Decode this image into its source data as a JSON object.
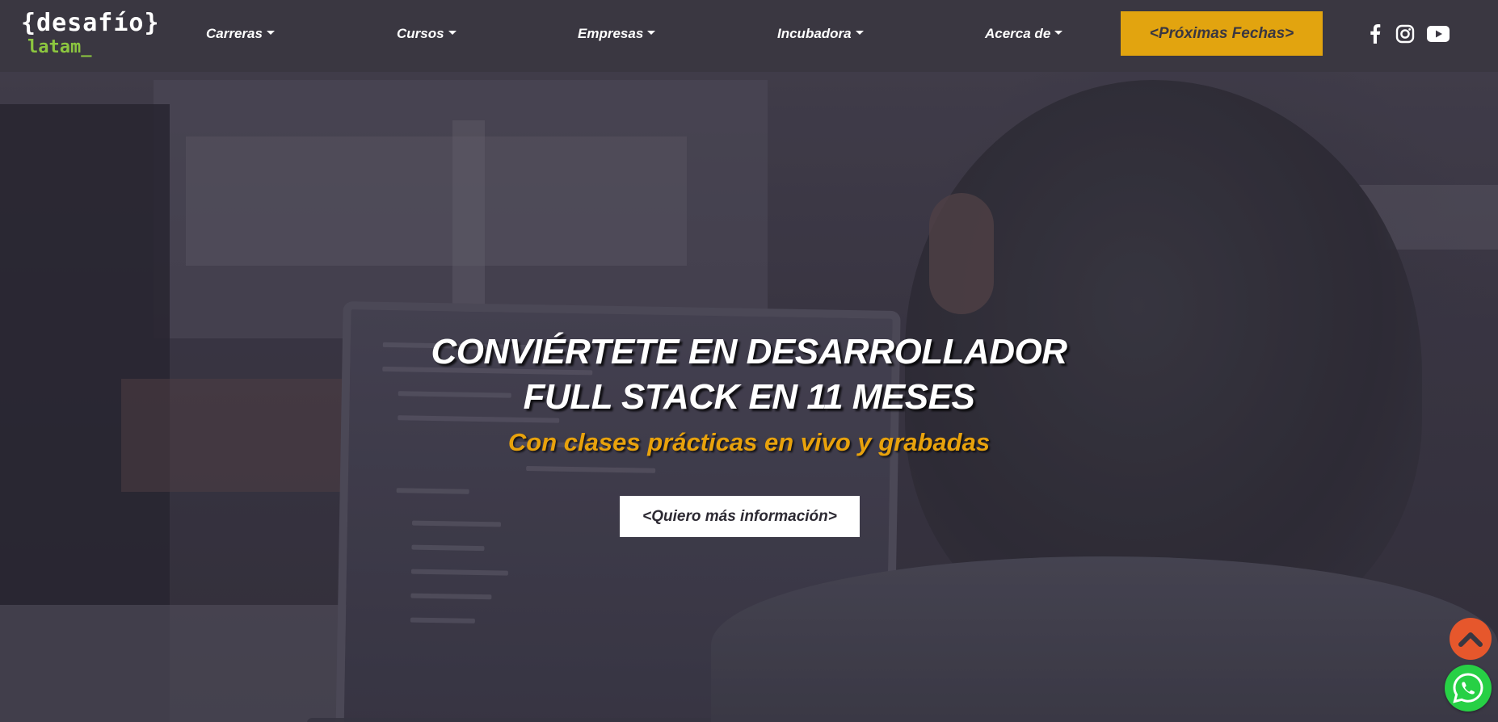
{
  "header": {
    "logo": {
      "top": "{desafío}",
      "bottom": "latam_"
    },
    "nav": [
      {
        "label": "Carreras"
      },
      {
        "label": "Cursos"
      },
      {
        "label": "Empresas"
      },
      {
        "label": "Incubadora"
      },
      {
        "label": "Acerca de"
      }
    ],
    "cta_label": "<Próximas Fechas>",
    "social_icons": [
      "facebook-icon",
      "instagram-icon",
      "youtube-icon"
    ]
  },
  "hero": {
    "title_line1": "CONVIÉRTETE EN DESARROLLADOR",
    "title_line2": "FULL STACK EN 11 MESES",
    "subtitle": "Con clases prácticas en vivo y grabadas",
    "button_label": "<Quiero más información>"
  },
  "floating": {
    "scroll_top_icon": "chevron-up-icon",
    "chat_icon": "whatsapp-icon"
  },
  "colors": {
    "header_bg": "#3a3741",
    "accent_yellow": "#e2a40f",
    "logo_green": "#8cc63f",
    "scroll_top_bg": "#e6572c",
    "whatsapp_green": "#27d045"
  }
}
